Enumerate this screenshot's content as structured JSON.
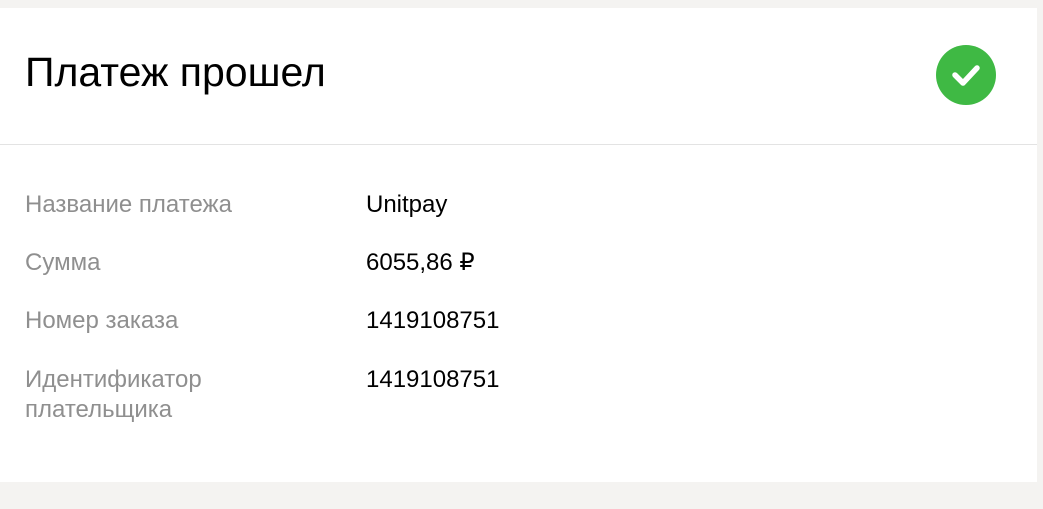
{
  "page": {
    "title": "Платеж прошел",
    "status_icon": "check-circle-icon",
    "status_color": "#3fb944"
  },
  "details": [
    {
      "label": "Название платежа",
      "value": "Unitpay"
    },
    {
      "label": "Сумма",
      "value": "6055,86 ₽"
    },
    {
      "label": "Номер заказа",
      "value": "1419108751"
    },
    {
      "label": "Идентификатор плательщика",
      "value": "1419108751"
    }
  ]
}
